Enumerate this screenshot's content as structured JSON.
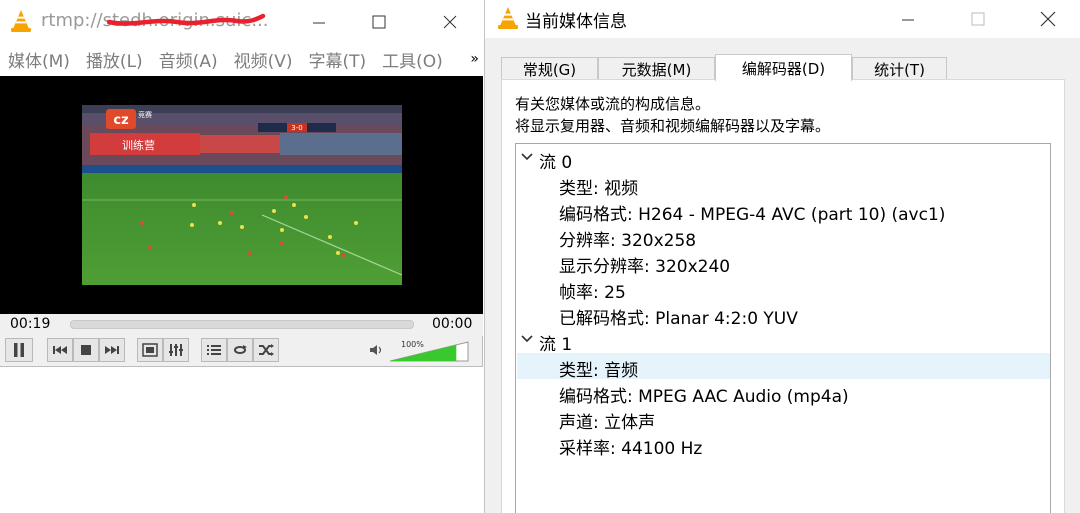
{
  "player": {
    "title": "rtmp://stedh.origin.suic...",
    "menu": [
      "媒体(M)",
      "播放(L)",
      "音频(A)",
      "视频(V)",
      "字幕(T)",
      "工具(O)"
    ],
    "menu_more": "»",
    "time_current": "00:19",
    "time_total": "00:00",
    "seek_fraction": 0.0,
    "volume_label": "100%",
    "volume_level": 1.0,
    "controls": [
      "pause-icon",
      "prev-icon",
      "stop-icon",
      "next-icon",
      "fullscreen-icon",
      "extended-settings-icon",
      "playlist-icon",
      "loop-icon",
      "shuffle-icon"
    ],
    "overlay": {
      "logo_text": "cz",
      "logo_side": "竞赛",
      "score": "3-0",
      "banner": "训练营"
    }
  },
  "info": {
    "title": "当前媒体信息",
    "tabs": [
      "常规(G)",
      "元数据(M)",
      "编解码器(D)",
      "统计(T)"
    ],
    "active_tab": 2,
    "desc1": "有关您媒体或流的构成信息。",
    "desc2": "将显示复用器、音频和视频编解码器以及字幕。",
    "tree": [
      {
        "label": "流 0",
        "level": 0
      },
      {
        "label": "类型: 视频",
        "level": 1
      },
      {
        "label": "编码格式: H264 - MPEG-4 AVC (part 10) (avc1)",
        "level": 1
      },
      {
        "label": "分辨率: 320x258",
        "level": 1
      },
      {
        "label": "显示分辨率: 320x240",
        "level": 1
      },
      {
        "label": "帧率: 25",
        "level": 1
      },
      {
        "label": "已解码格式: Planar 4:2:0 YUV",
        "level": 1
      },
      {
        "label": "流 1",
        "level": 0
      },
      {
        "label": "类型: 音频",
        "level": 1,
        "selected": true
      },
      {
        "label": "编码格式: MPEG AAC Audio (mp4a)",
        "level": 1
      },
      {
        "label": "声道: 立体声",
        "level": 1
      },
      {
        "label": "采样率: 44100 Hz",
        "level": 1
      }
    ]
  },
  "colors": {
    "vlc_orange": "#f7a300",
    "volume_green": "#39c82e",
    "selection": "#e5f3fb"
  }
}
